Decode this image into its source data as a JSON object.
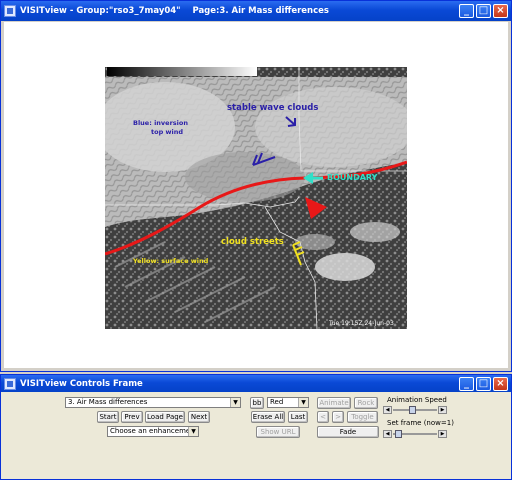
{
  "main_window": {
    "title": "VISITview - Group:\"rso3_7may04\"    Page:3. Air Mass differences"
  },
  "image": {
    "labels": {
      "stable_wave_clouds": "stable wave clouds",
      "blue_line1": "Blue: inversion",
      "blue_line2": "top wind",
      "boundary": "BOUNDARY",
      "cloud_streets": "cloud streets",
      "yellow_surface": "Yellow: surface wind"
    },
    "timestamp": "Tue 19:15Z 24-Jun-03"
  },
  "controls_window": {
    "title": "VISITview Controls Frame",
    "page_select": "3. Air Mass differences",
    "buttons": {
      "start": "Start",
      "prev": "Prev",
      "load_page": "Load Page",
      "next": "Next",
      "bb": "bb",
      "erase_all": "Erase All",
      "last": "Last",
      "show_url": "Show URL",
      "animate": "Animate",
      "rock": "Rock",
      "step_back": "<",
      "step_fwd": ">",
      "toggle": "Toggle",
      "fade": "Fade"
    },
    "enhancement_select": "Choose an enhancement",
    "color_select": "Red",
    "animation_speed_label": "Animation Speed",
    "set_frame_label": "Set frame (now=1)"
  },
  "colors": {
    "boundary_line": "#e81818",
    "blue_annotation": "#2a1fa8",
    "yellow_annotation": "#f0e020",
    "cyan_annotation": "#30e0c8",
    "titlebar": "#0a49d6"
  }
}
